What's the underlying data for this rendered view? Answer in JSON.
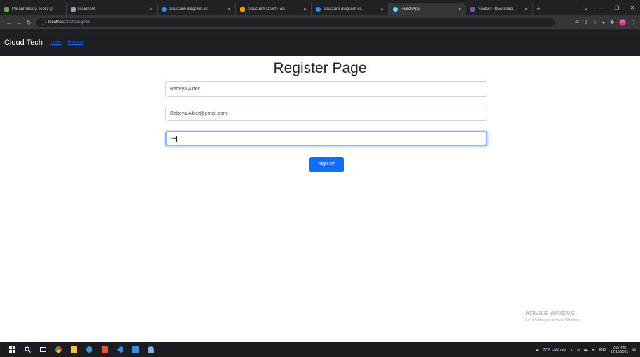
{
  "browser": {
    "tabs": [
      {
        "label": "Paraphrasing Tool | Q",
        "color": "#6aa84f",
        "active": false
      },
      {
        "label": "localhost",
        "color": "#9aa0a6",
        "active": false
      },
      {
        "label": "structure diagram ex",
        "color": "#4285f4",
        "active": false
      },
      {
        "label": "Structure Chart - an",
        "color": "#f29900",
        "active": false
      },
      {
        "label": "structure diagram ex",
        "color": "#4285f4",
        "active": false
      },
      {
        "label": "React App",
        "color": "#61dafb",
        "active": true
      },
      {
        "label": "Navbar · Bootstrap",
        "color": "#7952b3",
        "active": false
      }
    ],
    "url_host": "localhost",
    "url_path": ":3000/register",
    "profile_initial": "M"
  },
  "app": {
    "brand": "Cloud Tech",
    "nav": {
      "login": "Login",
      "register": "Register"
    }
  },
  "form": {
    "title": "Register Page",
    "name_value": "Rabeya Akter",
    "email_value": "Rabeya.Akter@gmail.com",
    "password_value": "•••",
    "submit_label": "Sign Up"
  },
  "windows": {
    "activate_title": "Activate Windows",
    "activate_sub": "Go to Settings to activate Windows.",
    "weather": "77°F Light rain",
    "time": "2:07 PM",
    "date": "12/19/2021"
  },
  "colors": {
    "primary": "#0d6efd",
    "navbar": "#1f2024"
  }
}
